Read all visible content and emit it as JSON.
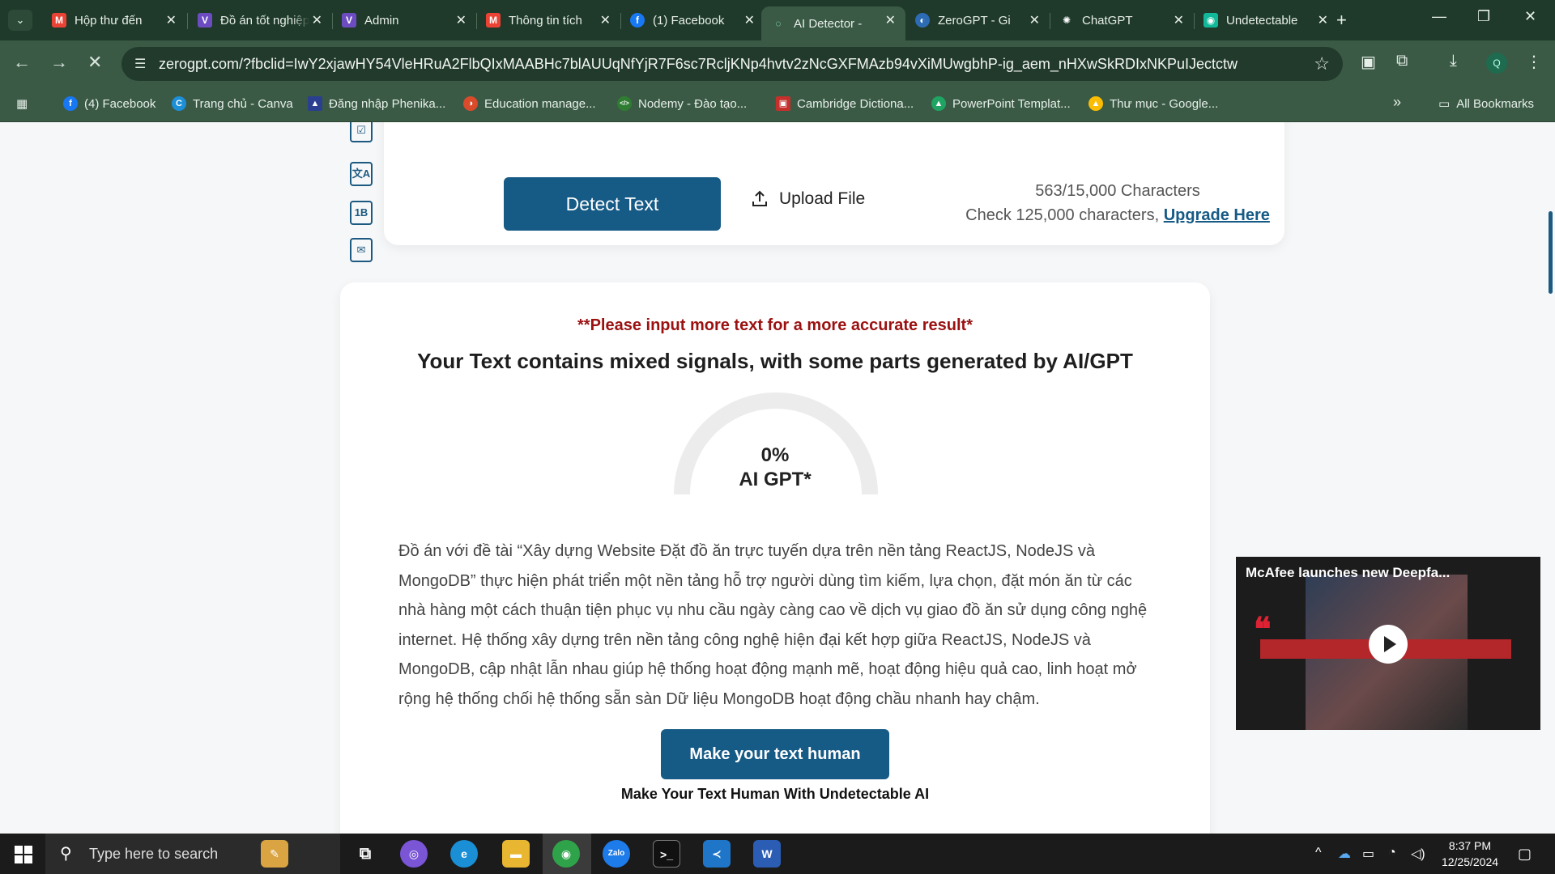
{
  "tabs": [
    {
      "title": "Hộp thư đến",
      "favicon": "gmail-icon",
      "color": "#ea4335",
      "glyph": "M"
    },
    {
      "title": "Đồ án tốt nghiệp",
      "favicon": "vuetify-icon",
      "color": "#6d4cc2",
      "glyph": "V"
    },
    {
      "title": "Admin",
      "favicon": "vuetify-icon",
      "color": "#6d4cc2",
      "glyph": "V"
    },
    {
      "title": "Thông tin tích",
      "favicon": "gmail-icon",
      "color": "#ea4335",
      "glyph": "M"
    },
    {
      "title": "(1) Facebook",
      "favicon": "facebook-icon",
      "color": "#1877f2",
      "glyph": "f"
    },
    {
      "title": "AI Detector -",
      "favicon": "loading-icon",
      "color": "#3a5a45",
      "glyph": "◌"
    },
    {
      "title": "ZeroGPT - Gi",
      "favicon": "zerogpt-icon",
      "color": "#2d6cb5",
      "glyph": "◐"
    },
    {
      "title": "ChatGPT",
      "favicon": "chatgpt-icon",
      "color": "#1f3a2a",
      "glyph": "✺"
    },
    {
      "title": "Undetectable",
      "favicon": "undetectable-icon",
      "color": "#11b99a",
      "glyph": "◉"
    }
  ],
  "url": "zerogpt.com/?fbclid=IwY2xjawHY54VleHRuA2FlbQIxMAABHc7blAUUqNfYjR7F6sc7RcljKNp4hvtv2zNcGXFMAzb94vXiMUwgbhP-ig_aem_nHXwSkRDIxNKPuIJectctw",
  "profile_initial": "Q",
  "bookmarks": [
    {
      "label": "(4) Facebook",
      "color": "#1877f2",
      "glyph": "f"
    },
    {
      "label": "Trang chủ - Canva",
      "color": "#1c8fd8",
      "glyph": "C"
    },
    {
      "label": "Đăng nhập Phenika...",
      "color": "#2a3f8f",
      "glyph": "▲"
    },
    {
      "label": "Education manage...",
      "color": "#d94b2b",
      "glyph": "◑"
    },
    {
      "label": "Nodemy - Đào tạo...",
      "color": "#2f7d32",
      "glyph": "</>"
    },
    {
      "label": "Cambridge Dictiona...",
      "color": "#c4302b",
      "glyph": "▣"
    },
    {
      "label": "PowerPoint Templat...",
      "color": "#1fa463",
      "glyph": "▲"
    },
    {
      "label": "Thư mục - Google...",
      "color": "#fbbc04",
      "glyph": "▲"
    }
  ],
  "bookmarks_overflow": "»",
  "all_bookmarks": "All Bookmarks",
  "detector": {
    "detect_button": "Detect Text",
    "upload_label": "Upload File",
    "char_count": "563/15,000 Characters",
    "check_prefix": "Check 125,000 characters,",
    "upgrade_link": "Upgrade Here"
  },
  "result": {
    "warning": "**Please input more text for a more accurate result*",
    "headline": "Your Text contains mixed signals, with some parts generated by AI/GPT",
    "percent": "0%",
    "gauge_label": "AI GPT*",
    "gauge_fraction": 0,
    "body": "Đồ án với đề tài “Xây dựng Website Đặt đồ ăn trực tuyến dựa trên nền tảng ReactJS, NodeJS và MongoDB” thực hiện phát triển một nền tảng hỗ trợ người dùng tìm kiếm, lựa chọn, đặt món ăn từ các nhà hàng một cách thuận tiện phục vụ nhu cầu ngày càng cao về dịch vụ giao đồ ăn sử dụng công nghệ internet. Hệ thống xây dựng trên nền tảng công nghệ hiện đại kết hợp giữa ReactJS, NodeJS và MongoDB, cập nhật lẫn nhau giúp hệ thống hoạt động mạnh mẽ, hoạt động hiệu quả cao, linh hoạt mở rộng hệ thống chối hệ thống sẵn sàn Dữ liệu MongoDB hoạt động chầu nhanh hay chậm.",
    "human_button": "Make your text human",
    "human_subtitle": "Make Your Text Human With Undetectable AI"
  },
  "video": {
    "title": "McAfee launches new Deepfa..."
  },
  "taskbar": {
    "search_placeholder": "Type here to search",
    "time": "8:37 PM",
    "date": "12/25/2024"
  },
  "colors": {
    "accent": "#165a86",
    "warning": "#9b1111",
    "chrome_dark": "#1f3a2a",
    "chrome_mid": "#3a5a45"
  }
}
